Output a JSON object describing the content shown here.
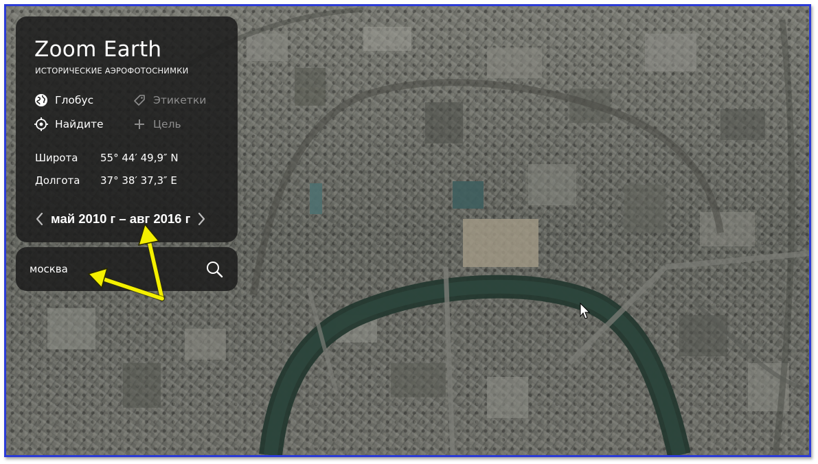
{
  "brand": {
    "title": "Zoom Earth",
    "subtitle": "ИСТОРИЧЕСКИЕ АЭРОФОТОСНИМКИ"
  },
  "menu": {
    "globe": {
      "label": "Глобус",
      "icon": "globe-icon"
    },
    "labels": {
      "label": "Этикетки",
      "icon": "tag-icon"
    },
    "find": {
      "label": "Найдите",
      "icon": "crosshair-icon"
    },
    "target": {
      "label": "Цель",
      "icon": "plus-icon"
    }
  },
  "coordinates": {
    "latitude_label": "Широта",
    "latitude_value": "55° 44′ 49,9″ N",
    "longitude_label": "Долгота",
    "longitude_value": "37° 38′ 37,3″ E"
  },
  "date_range": {
    "text": "май 2010 г – авг 2016 г",
    "prev_icon": "chevron-left-icon",
    "next_icon": "chevron-right-icon"
  },
  "search": {
    "value": "москва",
    "icon": "search-icon"
  },
  "colors": {
    "frame_border": "#2b3bd6",
    "panel_bg": "rgba(28,28,28,0.86)",
    "annotation_arrow": "#f4f000"
  }
}
